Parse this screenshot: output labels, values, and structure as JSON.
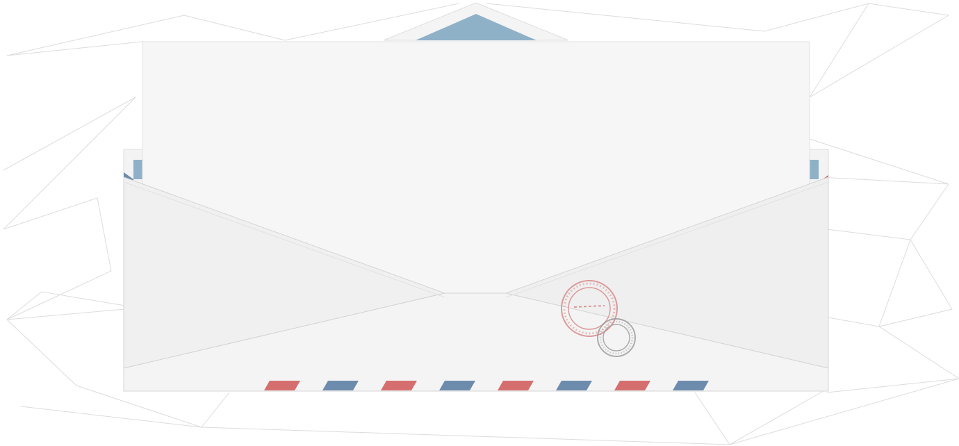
{
  "scene": {
    "background_color": "#ffffff",
    "mesh_line_color": "#dcdcdc",
    "paper_color": "#f6f6f6",
    "envelope_color": "#f1f1f1",
    "envelope_inner_color": "#f7f7f7",
    "liner_color": "#8fb1c8",
    "stripe_red": "#d56e6e",
    "stripe_blue": "#6d8cad",
    "stamp_red": "#d98a8a",
    "stamp_gray": "#9a9a9a"
  },
  "stamp": {
    "text": "",
    "date_text": ""
  }
}
